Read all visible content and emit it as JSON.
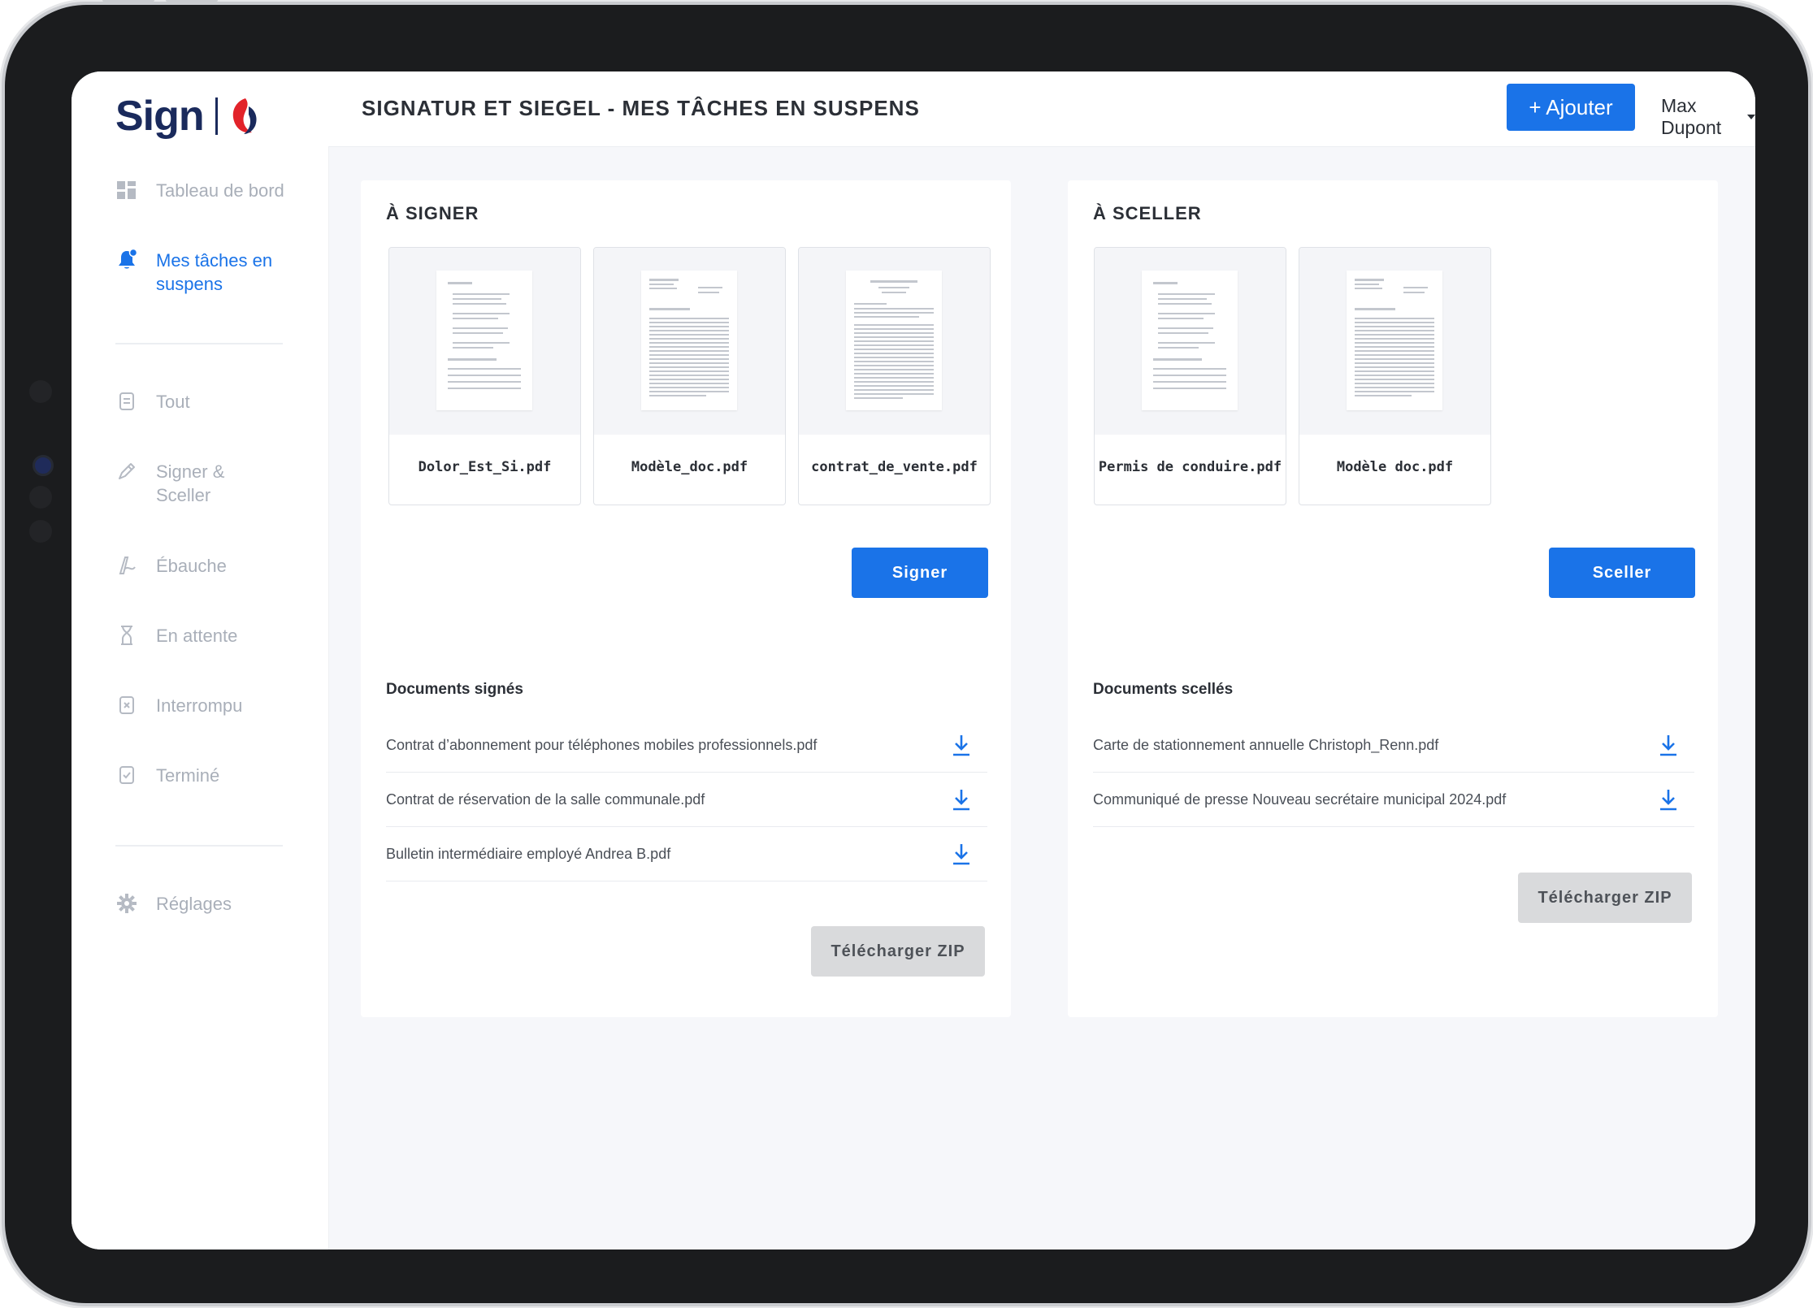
{
  "app": {
    "logo_text": "Sign",
    "page_title": "SIGNATUR ET SIEGEL - MES TÂCHES EN SUSPENS"
  },
  "header": {
    "add_label": "+ Ajouter",
    "user_name": "Max Dupont"
  },
  "sidebar": {
    "items": [
      {
        "label": "Tableau de bord",
        "icon": "dashboard-icon"
      },
      {
        "label": "Mes tâches en suspens",
        "icon": "bell-icon",
        "active": true
      },
      {
        "label": "Tout",
        "icon": "document-icon"
      },
      {
        "label": "Signer & Sceller",
        "icon": "pen-icon"
      },
      {
        "label": "Ébauche",
        "icon": "draft-icon"
      },
      {
        "label": "En attente",
        "icon": "hourglass-icon"
      },
      {
        "label": "Interrompu",
        "icon": "cancelled-icon"
      },
      {
        "label": "Terminé",
        "icon": "check-icon"
      }
    ],
    "settings_label": "Réglages"
  },
  "sign_panel": {
    "title": "À SIGNER",
    "documents": [
      "Dolor_Est_Si.pdf",
      "Modèle_doc.pdf",
      "contrat_de_vente.pdf"
    ],
    "action_label": "Signer",
    "completed_title": "Documents signés",
    "completed_files": [
      "Contrat d’abonnement pour téléphones mobiles professionnels.pdf",
      "Contrat de réservation de la salle communale.pdf",
      "Bulletin intermédiaire employé Andrea B.pdf"
    ],
    "zip_label": "Télécharger ZIP"
  },
  "seal_panel": {
    "title": "À SCELLER",
    "documents": [
      "Permis de conduire.pdf",
      "Modèle doc.pdf"
    ],
    "action_label": "Sceller",
    "completed_title": "Documents scellés",
    "completed_files": [
      "Carte de stationnement annuelle Christoph_Renn.pdf",
      "Communiqué de presse Nouveau secrétaire municipal 2024.pdf"
    ],
    "zip_label": "Télécharger ZIP"
  },
  "colors": {
    "accent": "#1a73e8",
    "brand_navy": "#1a2a5c",
    "brand_red": "#e2232a",
    "zip_button": "#d9dadc"
  }
}
